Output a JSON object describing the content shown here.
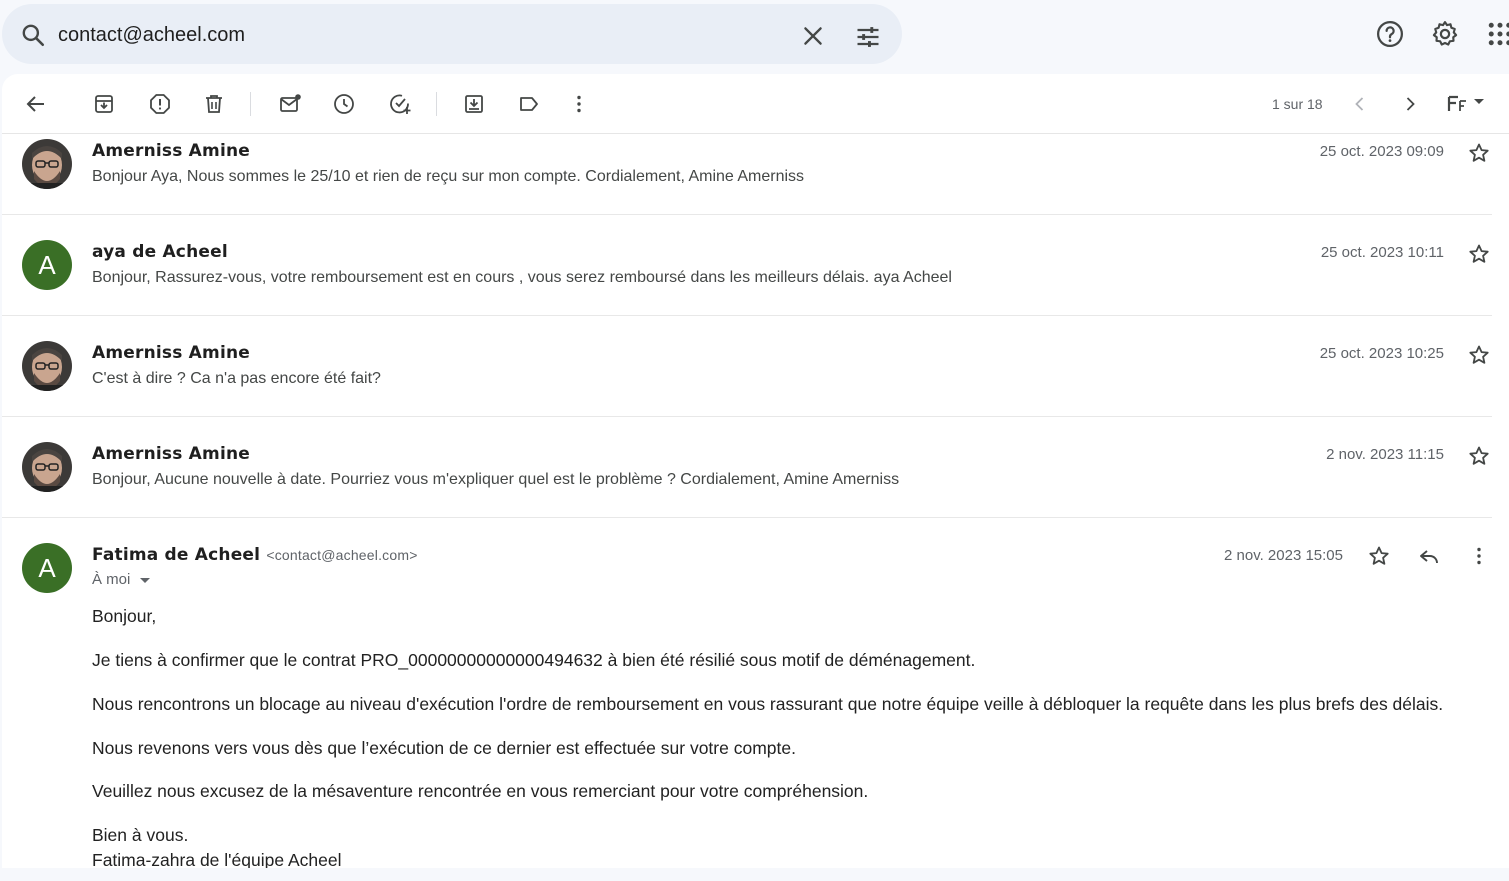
{
  "search": {
    "query": "contact@acheel.com"
  },
  "toolbar": {
    "pager": "1 sur 18"
  },
  "messages": [
    {
      "sender": "Amerniss Amine",
      "snippet": "Bonjour Aya, Nous sommes le 25/10 et rien de reçu sur mon compte. Cordialement, Amine Amerniss",
      "date": "25 oct. 2023 09:09"
    },
    {
      "sender": "aya de Acheel",
      "avatar_letter": "A",
      "snippet": "Bonjour, Rassurez-vous, votre remboursement est en cours , vous serez remboursé dans les meilleurs délais. aya Acheel",
      "date": "25 oct. 2023 10:11"
    },
    {
      "sender": "Amerniss Amine",
      "snippet": "C'est à dire ? Ca n'a pas encore été fait?",
      "date": "25 oct. 2023 10:25"
    },
    {
      "sender": "Amerniss Amine",
      "snippet": "Bonjour, Aucune nouvelle à date. Pourriez vous m'expliquer quel est le problème ? Cordialement, Amine Amerniss",
      "date": "2 nov. 2023 11:15"
    }
  ],
  "open_message": {
    "sender": "Fatima de Acheel",
    "email": "<contact@acheel.com>",
    "avatar_letter": "A",
    "date": "2 nov. 2023 15:05",
    "recipient": "À moi",
    "body": [
      "Bonjour,",
      "Je tiens à confirmer que le contrat PRO_00000000000000494632 à bien été résilié sous motif de déménagement.",
      "Nous rencontrons un blocage au niveau d'exécution l'ordre de remboursement en vous rassurant que notre équipe veille à débloquer la requête dans les plus brefs des délais.",
      "Nous revenons vers vous dès que l’exécution de ce dernier est effectuée sur votre compte.",
      "Veuillez nous excusez de la mésaventure rencontrée en vous remerciant pour votre compréhension.",
      "Bien à vous.",
      "Fatima-zahra de l'équipe Acheel"
    ]
  },
  "colors": {
    "avatar_green": "#3a6f26",
    "search_bg": "#e9eef6",
    "page_bg": "#f6f8fc"
  }
}
